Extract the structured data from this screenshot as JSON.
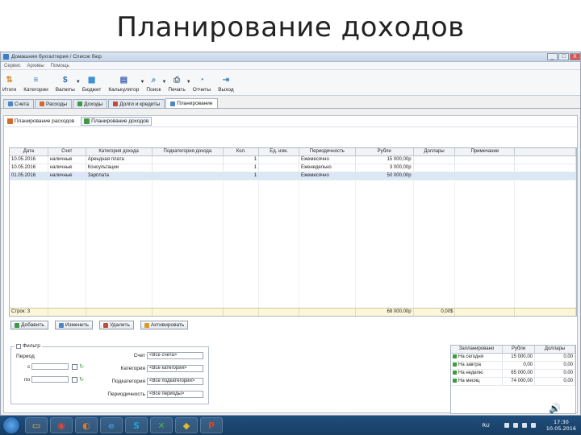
{
  "slide_title": "Планирование доходов",
  "window": {
    "title": "Домашняя бухгалтерия / Список бюр",
    "controls": [
      "_",
      "□",
      "X"
    ]
  },
  "menu": [
    "Сервис",
    "Архивы",
    "Помощь"
  ],
  "toolbar": [
    {
      "label": "Итоги",
      "icon": "chart-icon",
      "color": "#c98a2b",
      "glyph": "⇅",
      "arrow": false
    },
    {
      "label": "Категории",
      "icon": "categories-icon",
      "color": "#3b7bbf",
      "glyph": "≡",
      "arrow": false
    },
    {
      "label": "Валюты",
      "icon": "currency-icon",
      "color": "#2f6fb3",
      "glyph": "$",
      "arrow": true
    },
    {
      "label": "Бюджет",
      "icon": "budget-icon",
      "color": "#2d89c9",
      "glyph": "▦",
      "arrow": false
    },
    {
      "label": "Калькулятор",
      "icon": "calculator-icon",
      "color": "#3a5fa8",
      "glyph": "▤",
      "arrow": true
    },
    {
      "label": "Поиск",
      "icon": "search-icon",
      "color": "#4a7fb8",
      "glyph": "⌕",
      "arrow": true
    },
    {
      "label": "Печать",
      "icon": "print-icon",
      "color": "#5b6f86",
      "glyph": "⎙",
      "arrow": true
    },
    {
      "label": "Отчеты",
      "icon": "reports-icon",
      "color": "#4b78b6",
      "glyph": "◔",
      "arrow": false
    },
    {
      "label": "Выход",
      "icon": "exit-icon",
      "color": "#3a7fc0",
      "glyph": "⇥",
      "arrow": false
    }
  ],
  "tabs": [
    {
      "label": "Счета",
      "color": "#4c86c6",
      "active": false
    },
    {
      "label": "Расходы",
      "color": "#d46a2c",
      "active": false
    },
    {
      "label": "Доходы",
      "color": "#3d9a44",
      "active": false
    },
    {
      "label": "Долги и кредиты",
      "color": "#c44a3c",
      "active": false
    },
    {
      "label": "Планирование",
      "color": "#4c86c6",
      "active": true
    }
  ],
  "subtabs": [
    {
      "label": "Планирование расходов",
      "color": "#d46a2c",
      "active": false
    },
    {
      "label": "Планирование доходов",
      "color": "#3d9a44",
      "active": true
    }
  ],
  "grid": {
    "columns": [
      "Дата",
      "Счет",
      "Категория дохода",
      "Подкатегория дохода",
      "Кол.",
      "Ед. изм.",
      "Периодичность",
      "Рубли",
      "Доллары",
      "Примечание",
      ""
    ],
    "rows": [
      [
        "10.05.2016",
        "наличные",
        "Арендная плата",
        "",
        "1",
        "",
        "Ежемесячно",
        "15 000,00р",
        "",
        "",
        ""
      ],
      [
        "10.05.2016",
        "наличные",
        "Консультации",
        "",
        "1",
        "",
        "Еженедельно",
        "3 000,00р",
        "",
        "",
        ""
      ],
      [
        "01.05.2016",
        "наличные",
        "Зарплата",
        "",
        "1",
        "",
        "Ежемесячно",
        "50 000,00р",
        "",
        "",
        ""
      ]
    ],
    "selected_row": 2,
    "footer": [
      "Строк: 3",
      "",
      "",
      "",
      "",
      "",
      "",
      "68 000,00р",
      "0,00$",
      "",
      ""
    ]
  },
  "actions": [
    {
      "label": "Добавить",
      "color": "#3d9a44"
    },
    {
      "label": "Изменить",
      "color": "#4c86c6"
    },
    {
      "label": "Удалить",
      "color": "#c44a3c"
    },
    {
      "label": "Активировать",
      "color": "#d89a2b"
    }
  ],
  "filter": {
    "legend": "Фильтр",
    "period_label": "Период",
    "from_label": "с",
    "to_label": "по",
    "account_label": "Счет",
    "account_value": "<Все счета>",
    "category_label": "Категория",
    "category_value": "<Все категории>",
    "subcategory_label": "Подкатегория",
    "subcategory_value": "<Все подкатегории>",
    "periodicity_label": "Периодичность",
    "periodicity_value": "<Все периоды>"
  },
  "summary": {
    "columns": [
      "Запланировано",
      "Рубли",
      "Доллары"
    ],
    "rows": [
      [
        "На сегодня",
        "15 000,00",
        "0,00"
      ],
      [
        "На завтра",
        "0,00",
        "0,00"
      ],
      [
        "На неделю",
        "65 000,00",
        "0,00"
      ],
      [
        "На месяц",
        "74 000,00",
        "0,00"
      ]
    ]
  },
  "taskbar": {
    "apps": [
      {
        "name": "explorer-icon",
        "glyph": "▭",
        "color": "#e2b44a"
      },
      {
        "name": "chrome-icon",
        "glyph": "◉",
        "color": "#d9493b"
      },
      {
        "name": "firefox-icon",
        "glyph": "◐",
        "color": "#e07a2a"
      },
      {
        "name": "ie-icon",
        "glyph": "e",
        "color": "#3c8ed6"
      },
      {
        "name": "skype-icon",
        "glyph": "S",
        "color": "#1ea3dc"
      },
      {
        "name": "app-icon",
        "glyph": "✕",
        "color": "#4caf50"
      },
      {
        "name": "media-icon",
        "glyph": "◆",
        "color": "#e0b82a"
      },
      {
        "name": "powerpoint-icon",
        "glyph": "P",
        "color": "#d24726"
      }
    ],
    "lang": "RU",
    "time": "17:30",
    "date": "10.05.2016"
  }
}
